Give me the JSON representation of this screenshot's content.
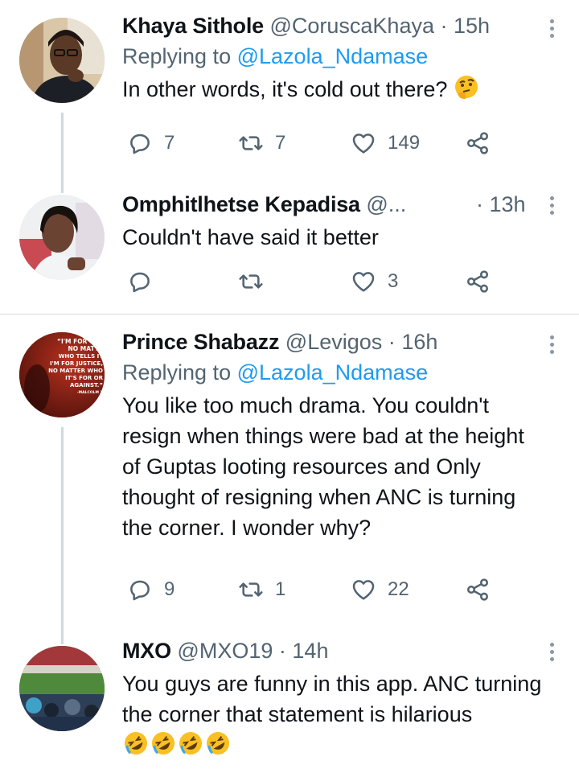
{
  "tweets": [
    {
      "name": "Khaya Sithole",
      "handle": "@CoruscaKhaya",
      "dot": "·",
      "time": "15h",
      "replying_prefix": "Replying to",
      "replying_to": "@Lazola_Ndamase",
      "text": "In other words, it's cold out there?",
      "emoji": "thinking-face",
      "replies": "7",
      "retweets": "7",
      "likes": "149"
    },
    {
      "name": "Omphitlhetse Kepadisa",
      "handle": "@...",
      "dot": "·",
      "time": "13h",
      "text": "Couldn't have said it better",
      "replies": "",
      "retweets": "",
      "likes": "3"
    },
    {
      "name": "Prince Shabazz",
      "handle": "@Levigos",
      "dot": "·",
      "time": "16h",
      "replying_prefix": "Replying to",
      "replying_to": "@Lazola_Ndamase",
      "text": "You like too much drama. You couldn't resign when things were bad at the height of Guptas looting resources and Only thought of resigning when ANC is turning the corner. I wonder why?",
      "avatar_quote": [
        "“I'M FOR TRU",
        "NO MATTE",
        "WHO TELLS IT",
        "I'M FOR JUSTICE,",
        "NO MATTER WHO",
        "IT'S FOR OR",
        "AGAINST.”",
        "-MALCOLM X"
      ],
      "replies": "9",
      "retweets": "1",
      "likes": "22"
    },
    {
      "name": "MXO",
      "handle": "@MXO19",
      "dot": "·",
      "time": "14h",
      "text": "You guys are funny in this app. ANC turning the corner that statement is hilarious",
      "emoji": "rolling-on-floor-laughing x4"
    }
  ],
  "colors": {
    "accent": "#1d9bf0",
    "secondary_text": "#536471",
    "primary_text": "#0f1419",
    "border": "#cfd9de",
    "emoji_yellow": "#f9c023"
  }
}
